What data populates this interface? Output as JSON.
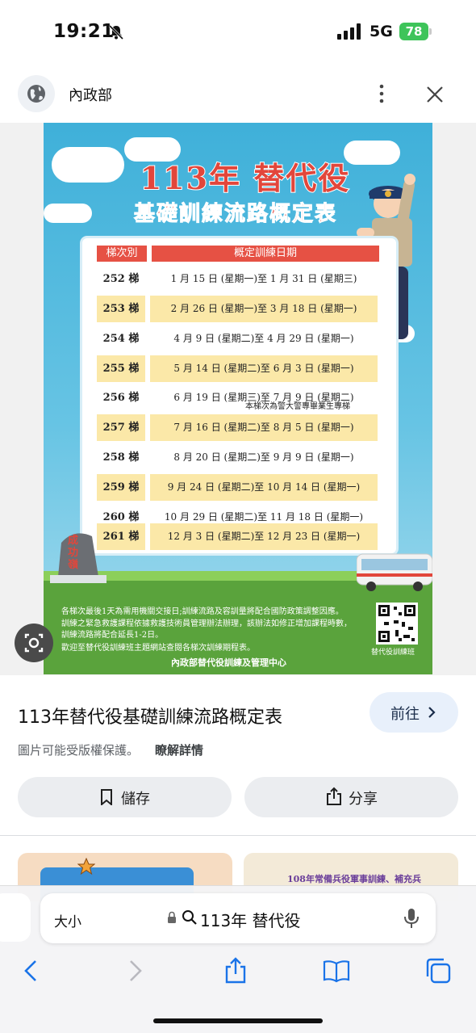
{
  "status_bar": {
    "time": "19:21",
    "network": "5G",
    "battery": "78"
  },
  "site": {
    "name": "內政部"
  },
  "poster": {
    "title_line1": "113年 替代役",
    "title_line2": "基礎訓練流路概定表",
    "col_headers": [
      "梯次別",
      "概定訓練日期"
    ],
    "rows": [
      {
        "batch": "252 梯",
        "dates": "1 月 15 日 (星期一)至  1 月 31 日 (星期三)"
      },
      {
        "batch": "253 梯",
        "dates": "2 月 26 日 (星期一)至  3 月 18 日 (星期一)"
      },
      {
        "batch": "254 梯",
        "dates": "4 月  9  日 (星期二)至  4 月 29 日 (星期一)"
      },
      {
        "batch": "255 梯",
        "dates": "5 月 14 日 (星期二)至  6 月  3  日 (星期一)"
      },
      {
        "batch": "256 梯",
        "dates": "6 月 19 日 (星期三)至  7 月  9  日 (星期二)"
      },
      {
        "batch": "257 梯",
        "dates": "7 月 16 日 (星期二)至  8 月  5  日 (星期一)"
      },
      {
        "batch": "258 梯",
        "dates": "8 月 20 日 (星期二)至  9 月  9  日 (星期一)"
      },
      {
        "batch": "259 梯",
        "dates": "9 月 24 日 (星期二)至 10 月 14 日 (星期一)"
      },
      {
        "batch": "260 梯",
        "dates": "10 月 29 日 (星期二)至 11 月 18 日 (星期一)"
      },
      {
        "batch": "261 梯",
        "dates": "12 月  3  日 (星期二)至 12 月 23 日 (星期一)"
      }
    ],
    "note": "本梯次為警大警專畢業生專梯",
    "stone_text": "成功嶺",
    "footer_lines": [
      "各梯次最後1天為需用機關交接日;訓練流路及容訓量將配合國防政策調整因應。",
      "訓練之緊急救護課程依據救護技術員管理辦法辦理，該辦法如修正增加課程時數，",
      "訓練流路將配合延長1-2日。",
      "歡迎至替代役訓練班主題網站查閱各梯次訓練期程表。"
    ],
    "qr_label": "替代役訓練班",
    "org": "內政部替代役訓練及管理中心"
  },
  "result": {
    "title": "113年替代役基礎訓練流路概定表",
    "go_label": "前往",
    "copyright": "圖片可能受版權保護。",
    "details_link": "瞭解詳情",
    "save_label": "儲存",
    "share_label": "分享"
  },
  "related": {
    "thumb2_text": "108年常備兵役軍事訓練、補充兵"
  },
  "browser": {
    "text_size_label": "大小",
    "query": "113年 替代役"
  }
}
